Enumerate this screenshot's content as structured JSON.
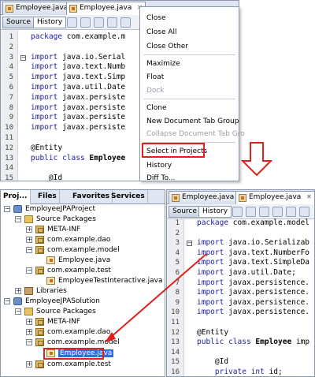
{
  "top_editor": {
    "tabs": [
      {
        "label": "Employee.java",
        "active": false
      },
      {
        "label": "Employee.java",
        "active": true
      }
    ],
    "toolbar": {
      "source_label": "Source",
      "history_label": "History"
    },
    "code_lines": [
      {
        "n": "1",
        "text": "package com.example.m"
      },
      {
        "n": "2",
        "text": ""
      },
      {
        "n": "3",
        "text": "import java.io.Serial"
      },
      {
        "n": "4",
        "text": "import java.text.Numb"
      },
      {
        "n": "5",
        "text": "import java.text.Simp"
      },
      {
        "n": "6",
        "text": "import java.util.Date"
      },
      {
        "n": "7",
        "text": "import javax.persiste"
      },
      {
        "n": "8",
        "text": "import javax.persiste"
      },
      {
        "n": "9",
        "text": "import javax.persiste"
      },
      {
        "n": "10",
        "text": "import javax.persiste"
      },
      {
        "n": "11",
        "text": ""
      },
      {
        "n": "12",
        "text": "@Entity"
      },
      {
        "n": "13",
        "text": "public class Employee"
      },
      {
        "n": "14",
        "text": ""
      },
      {
        "n": "15",
        "text": "    @Id"
      }
    ]
  },
  "context_menu": {
    "items": [
      {
        "label": "Close",
        "disabled": false
      },
      {
        "label": "Close All",
        "disabled": false
      },
      {
        "label": "Close Other",
        "disabled": false
      },
      {
        "label": "Maximize",
        "disabled": false
      },
      {
        "label": "Float",
        "disabled": false
      },
      {
        "label": "Dock",
        "disabled": true
      },
      {
        "label": "Clone",
        "disabled": false
      },
      {
        "label": "New Document Tab Group",
        "disabled": false
      },
      {
        "label": "Collapse Document Tab Gro",
        "disabled": true
      },
      {
        "label": "Select in Projects",
        "disabled": false,
        "highlighted": true
      },
      {
        "label": "History",
        "disabled": false
      },
      {
        "label": "Diff To...",
        "disabled": false
      }
    ]
  },
  "projects_panel": {
    "tabs": [
      "Proj...",
      "Files",
      "Favorites",
      "Services"
    ],
    "tree": [
      {
        "label": "EmployeeJPAProject"
      },
      {
        "label": "Source Packages"
      },
      {
        "label": "META-INF"
      },
      {
        "label": "com.example.dao"
      },
      {
        "label": "com.example.model"
      },
      {
        "label": "Employee.java"
      },
      {
        "label": "com.example.test"
      },
      {
        "label": "EmployeeTestInteractive.java"
      },
      {
        "label": "Libraries"
      },
      {
        "label": "EmployeeJPASolution"
      },
      {
        "label": "Source Packages"
      },
      {
        "label": "META-INF"
      },
      {
        "label": "com.example.dao"
      },
      {
        "label": "com.example.model"
      },
      {
        "label": "Employee.java",
        "selected": true
      },
      {
        "label": "com.example.test"
      }
    ]
  },
  "bottom_editor": {
    "tabs": [
      {
        "label": "Employee.java",
        "active": false
      },
      {
        "label": "Employee.java",
        "active": true
      }
    ],
    "toolbar": {
      "source_label": "Source",
      "history_label": "History"
    },
    "code_lines": [
      {
        "n": "1",
        "text": "package com.example.model"
      },
      {
        "n": "2",
        "text": ""
      },
      {
        "n": "3",
        "text": "import java.io.Serializab"
      },
      {
        "n": "4",
        "text": "import java.text.NumberFo"
      },
      {
        "n": "5",
        "text": "import java.text.SimpleDa"
      },
      {
        "n": "6",
        "text": "import java.util.Date;"
      },
      {
        "n": "7",
        "text": "import javax.persistence."
      },
      {
        "n": "8",
        "text": "import javax.persistence."
      },
      {
        "n": "9",
        "text": "import javax.persistence."
      },
      {
        "n": "10",
        "text": "import javax.persistence."
      },
      {
        "n": "11",
        "text": ""
      },
      {
        "n": "12",
        "text": "@Entity"
      },
      {
        "n": "13",
        "text": "public class Employee imp"
      },
      {
        "n": "14",
        "text": ""
      },
      {
        "n": "15",
        "text": "    @Id"
      },
      {
        "n": "16",
        "text": "    private int id;"
      }
    ]
  },
  "colors": {
    "highlight": "#e0201a",
    "selection": "#2f6fd6",
    "keyword": "#1a1aa6"
  }
}
